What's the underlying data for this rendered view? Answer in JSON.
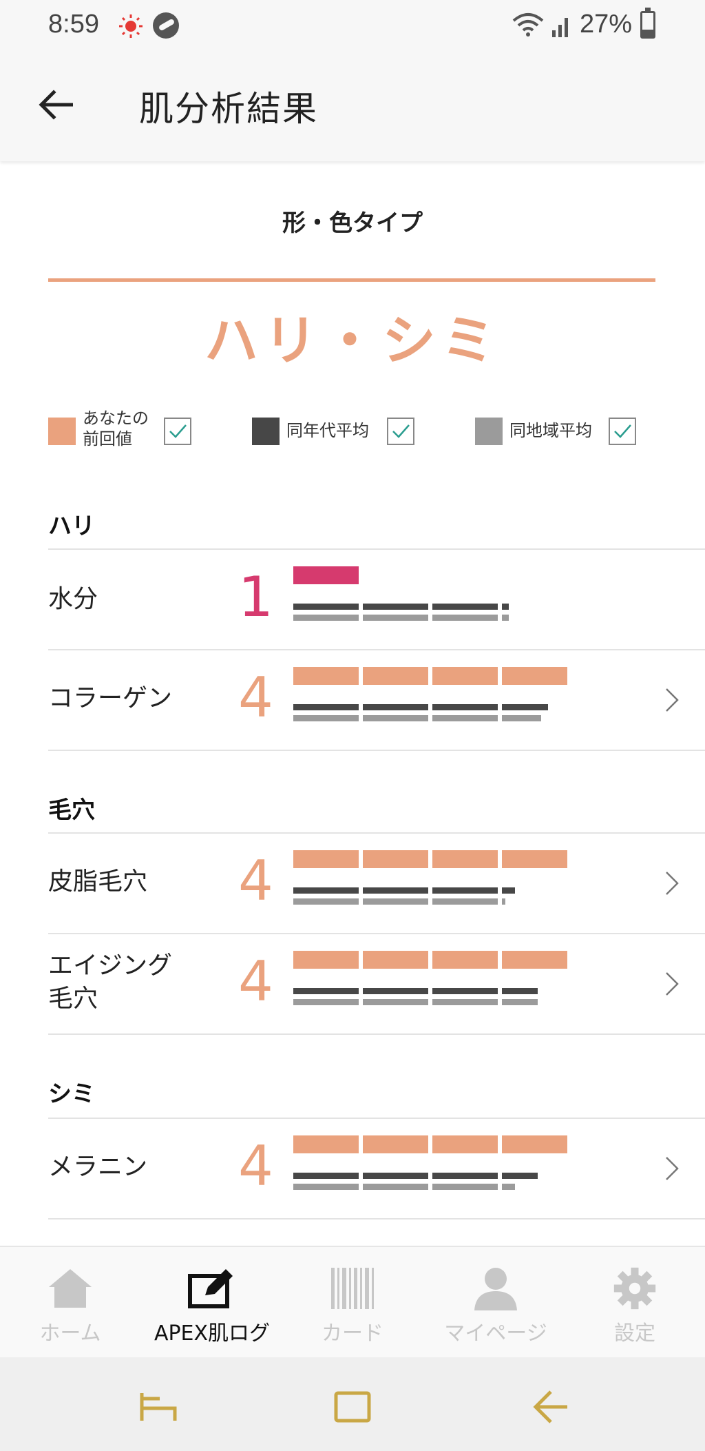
{
  "status_bar": {
    "time": "8:59",
    "battery": "27%"
  },
  "header": {
    "title": "肌分析結果"
  },
  "type_section": {
    "heading": "形・色タイプ",
    "result": "ハリ・シミ"
  },
  "legend": [
    {
      "label": "あなたの\n前回値",
      "color": "#eaa27e",
      "checked": true
    },
    {
      "label": "同年代平均",
      "color": "#474747",
      "checked": true
    },
    {
      "label": "同地域平均",
      "color": "#9b9b9b",
      "checked": true
    }
  ],
  "groups": [
    {
      "title": "ハリ",
      "rows": [
        {
          "label": "水分",
          "score": "1",
          "score_color": "#d63a6e",
          "yours": 1,
          "age_avg": 3.1,
          "region_avg": 3.1,
          "has_detail": false
        },
        {
          "label": "コラーゲン",
          "score": "4",
          "score_color": "#eaa27e",
          "yours": 4,
          "age_avg": 3.7,
          "region_avg": 3.6,
          "has_detail": true
        }
      ]
    },
    {
      "title": "毛穴",
      "rows": [
        {
          "label": "皮脂毛穴",
          "score": "4",
          "score_color": "#eaa27e",
          "yours": 4,
          "age_avg": 3.2,
          "region_avg": 3.05,
          "has_detail": true
        },
        {
          "label": "エイジング\n毛穴",
          "score": "4",
          "score_color": "#eaa27e",
          "yours": 4,
          "age_avg": 3.55,
          "region_avg": 3.55,
          "has_detail": true
        }
      ]
    },
    {
      "title": "シミ",
      "rows": [
        {
          "label": "メラニン",
          "score": "4",
          "score_color": "#eaa27e",
          "yours": 4,
          "age_avg": 3.55,
          "region_avg": 3.2,
          "has_detail": true
        }
      ]
    }
  ],
  "bottom_nav": [
    {
      "label": "ホーム",
      "icon": "home-icon",
      "active": false
    },
    {
      "label": "APEX肌ログ",
      "icon": "edit-log-icon",
      "active": true
    },
    {
      "label": "カード",
      "icon": "barcode-icon",
      "active": false
    },
    {
      "label": "マイページ",
      "icon": "person-icon",
      "active": false
    },
    {
      "label": "設定",
      "icon": "gear-icon",
      "active": false
    }
  ],
  "colors": {
    "accent": "#eaa27e",
    "low_score": "#d63a6e",
    "age_avg": "#474747",
    "region_avg": "#9b9b9b"
  }
}
